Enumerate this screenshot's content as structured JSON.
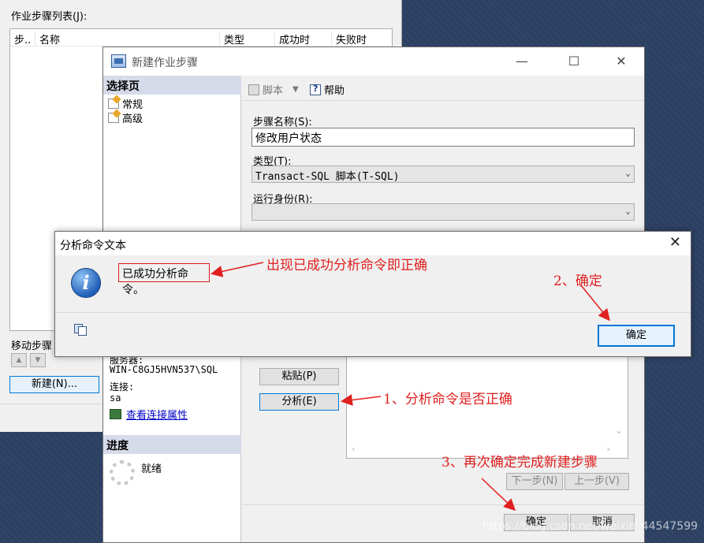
{
  "background_window": {
    "list_label": "作业步骤列表(J):",
    "columns": [
      "步..",
      "名称",
      "类型",
      "成功时",
      "失败时"
    ],
    "move_label": "移动步骤",
    "new_button": "新建(N)..."
  },
  "new_step_dialog": {
    "title": "新建作业步骤",
    "select_page": "选择页",
    "nav": [
      "常规",
      "高级"
    ],
    "toolbar": {
      "script": "脚本",
      "help": "帮助"
    },
    "step_name_label": "步骤名称(S):",
    "step_name_value": "修改用户状态",
    "type_label": "类型(T):",
    "type_value": "Transact-SQL 脚本(T-SQL)",
    "run_as_label": "运行身份(R):",
    "server_label": "服务器:",
    "server_value": "WIN-C8GJ5HVN537\\SQL",
    "connection_label": "连接:",
    "connection_value": "sa",
    "view_conn_props": "查看连接属性",
    "progress_label": "进度",
    "progress_status": "就绪",
    "paste_button": "粘贴(P)",
    "parse_button": "分析(E)",
    "next_button": "下一步(N)",
    "prev_button": "上一步(V)",
    "ok_button": "确定",
    "cancel_button": "取消"
  },
  "message_box": {
    "title": "分析命令文本",
    "message": "已成功分析命令。",
    "ok_button": "确定"
  },
  "annotations": {
    "a1": "出现已成功分析命令即正确",
    "a2": "2、确定",
    "a3": "1、分析命令是否正确",
    "a4": "3、再次确定完成新建步骤",
    "color": "#e02020"
  },
  "watermark": "https://blog.csdn.net/weixin_44547599"
}
